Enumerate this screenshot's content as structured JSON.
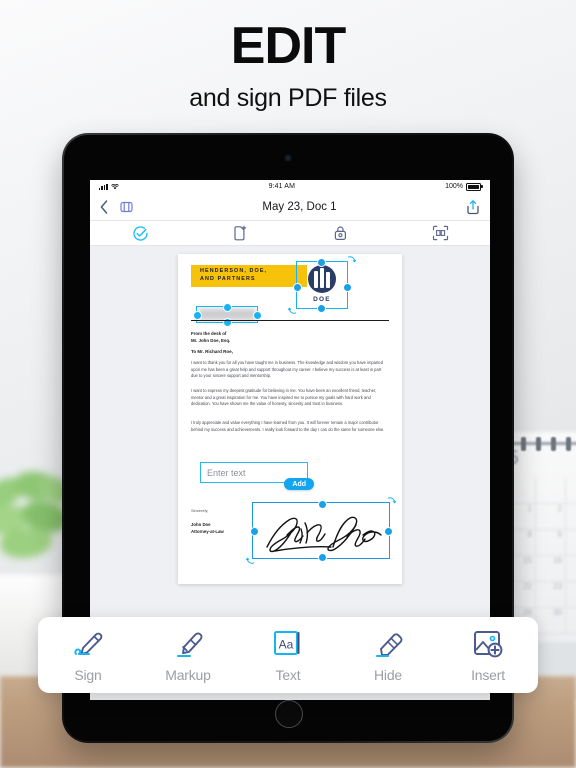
{
  "promo": {
    "headline": "EDIT",
    "subhead": "and sign PDF files"
  },
  "colors": {
    "accent_cyan": "#18b4f2",
    "accent_blue": "#12a5f0",
    "brand_navy": "#2b3c66",
    "banner_yellow": "#f7c20b"
  },
  "device": {
    "type": "tablet",
    "camera_icon": "camera-dot",
    "home_button_icon": "home-button"
  },
  "status_bar": {
    "signal_icon": "cellular-bars-icon",
    "wifi_icon": "wifi-icon",
    "time": "9:41 AM",
    "battery_percent": "100%",
    "battery_icon": "battery-full-icon"
  },
  "nav_bar": {
    "back_icon": "chevron-left-icon",
    "pages_icon": "page-thumbnail-icon",
    "title": "May 23, Doc 1",
    "share_icon": "share-upload-icon"
  },
  "toolbar": {
    "items": [
      {
        "icon": "check-circle-icon",
        "name": "done",
        "active": true
      },
      {
        "icon": "add-page-icon",
        "name": "add-page",
        "active": false
      },
      {
        "icon": "lock-icon",
        "name": "protect",
        "active": false
      },
      {
        "icon": "scan-crop-icon",
        "name": "scan",
        "active": false
      }
    ]
  },
  "document": {
    "letterhead": {
      "line1": "HENDERSON, DOE,",
      "line2": "AND PARTNERS"
    },
    "address_block": {
      "redacted": true,
      "label": "blurred-address"
    },
    "logo": {
      "word": "DOE",
      "icon": "building-columns-logo"
    },
    "from_label": "From the desk of",
    "from_name": "Mr. John Doe, Esq.",
    "salutation": "To Mr. Richard Roe,",
    "paragraphs": [
      "I want to thank you for all you have taught me in business. The knowledge and wisdom you have imparted upon me has been a great help and support throughout my career. I believe my success is at least in part due to your sincere support and mentorship.",
      "I want to express my deepest gratitude for believing in me. You have been an excellent friend, teacher, mentor and a great inspiration for me. You have inspired me to pursue my goals with hard work and dedication. You have shown me the value of honesty, sincerity and trust in business.",
      "I truly appreciate and value everything I have learned from you. It will forever remain a major contributor behind my success and achievements. I really look forward to the day I can do the same for someone else."
    ],
    "closing": "Sincerely,",
    "signer_name": "John Doe",
    "signer_title": "Attorney-at-Law",
    "signature_text": "John Doe"
  },
  "text_widget": {
    "placeholder": "Enter text",
    "value": "",
    "add_label": "Add"
  },
  "bottom_toolbar": {
    "items": [
      {
        "label": "Sign",
        "icon": "pen-sign-icon",
        "active": false
      },
      {
        "label": "Markup",
        "icon": "highlighter-icon",
        "active": false
      },
      {
        "label": "Text",
        "icon": "text-aa-icon",
        "active": true
      },
      {
        "label": "Hide",
        "icon": "eraser-icon",
        "active": false
      },
      {
        "label": "Insert",
        "icon": "add-image-icon",
        "active": false
      }
    ]
  },
  "background": {
    "calendar_month_number": "5",
    "plant": "succulent-plant",
    "desk": "wooden-desk"
  }
}
